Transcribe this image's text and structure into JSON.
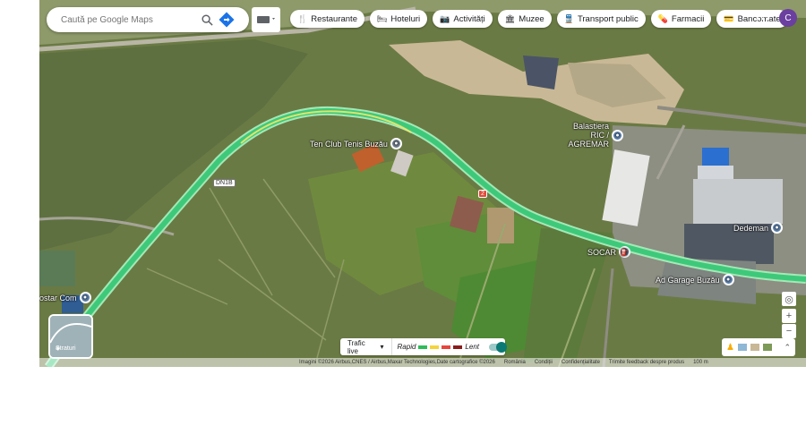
{
  "search": {
    "placeholder": "Caută pe Google Maps"
  },
  "categories": [
    {
      "icon": "restaurant-icon",
      "glyph": "🍴",
      "label": "Restaurante"
    },
    {
      "icon": "hotel-icon",
      "glyph": "🛏",
      "label": "Hoteluri"
    },
    {
      "icon": "camera-icon",
      "glyph": "📷",
      "label": "Activități"
    },
    {
      "icon": "museum-icon",
      "glyph": "🏛",
      "label": "Muzee"
    },
    {
      "icon": "transit-icon",
      "glyph": "🚆",
      "label": "Transport public"
    },
    {
      "icon": "pharmacy-icon",
      "glyph": "💊",
      "label": "Farmacii"
    },
    {
      "icon": "atm-icon",
      "glyph": "💳",
      "label": "Bancomate"
    }
  ],
  "account": {
    "initial": "C",
    "color": "#6b3fa0"
  },
  "places": {
    "tennis": "Ten Club Tenis Buzău",
    "balastiera": "Balastiera RIC / AGREMAR",
    "socar": "SOCAR",
    "dedeman": "Dedeman",
    "garage": "Ad Garage Buzău",
    "costar": "ostar Com"
  },
  "road_numbers": [
    "DN1B",
    "2"
  ],
  "layers_label": "Straturi",
  "traffic": {
    "label": "Trafic live",
    "fast": "Rapid",
    "slow": "Lent",
    "colors": [
      "#2ebd59",
      "#f5d43a",
      "#e8453c",
      "#8a1c1c"
    ]
  },
  "footer": {
    "credits": "Imagini ©2026 Airbus,CNES / Airbus,Maxar Technologies,Date cartografice ©2026",
    "country": "România",
    "terms": "Condiții",
    "privacy": "Confidențialitate",
    "feedback": "Trimite feedback despre produs",
    "scale": "100 m"
  },
  "colors": {
    "route": "#3ec97a",
    "route_edge": "#a4e8b6",
    "field": "#6b7c45",
    "quarry": "#c9b896"
  }
}
